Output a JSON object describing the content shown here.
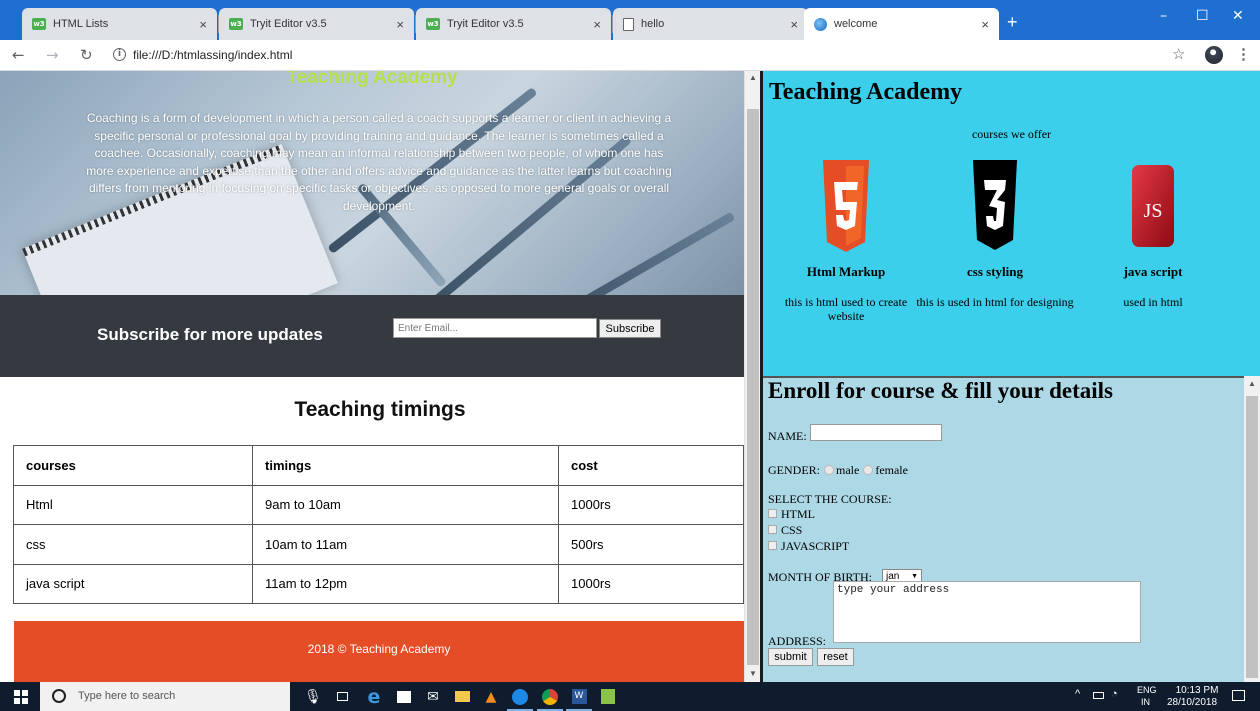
{
  "browser": {
    "tabs": [
      {
        "title": "HTML Lists",
        "icon": "w3-icon"
      },
      {
        "title": "Tryit Editor v3.5",
        "icon": "w3-icon"
      },
      {
        "title": "Tryit Editor v3.5",
        "icon": "w3-icon"
      },
      {
        "title": "hello",
        "icon": "document-icon"
      },
      {
        "title": "welcome",
        "icon": "globe-icon",
        "active": true
      }
    ],
    "close_glyph": "×",
    "new_tab_glyph": "+",
    "url": "file:///D:/htmlassing/index.html",
    "window_controls": [
      "–",
      "☐",
      "✕"
    ]
  },
  "left_page": {
    "hero": {
      "title": "Teaching Academy",
      "text": "Coaching is a form of development in which a person called a coach supports a learner or client in achieving a specific personal or professional goal by providing training and guidance. The learner is sometimes called a coachee. Occasionally, coaching may mean an informal relationship between two people, of whom one has more experience and expertise than the other and offers advice and guidance as the latter learns but coaching differs from mentoring in focusing on specific tasks or objectives, as opposed to more general goals or overall development."
    },
    "subscribe": {
      "title": "Subscribe for more updates",
      "email_placeholder": "Enter Email...",
      "button": "Subscribe"
    },
    "timings": {
      "title": "Teaching timings",
      "headers": [
        "courses",
        "timings",
        "cost"
      ],
      "rows": [
        [
          "Html",
          "9am to 10am",
          "1000rs"
        ],
        [
          "css",
          "10am to 11am",
          "500rs"
        ],
        [
          "java script",
          "11am to 12pm",
          "1000rs"
        ]
      ]
    },
    "footer": "2018 © Teaching Academy"
  },
  "right_top": {
    "title": "Teaching Academy",
    "subtitle": "courses we offer",
    "courses": [
      {
        "name": "Html Markup",
        "desc": "this is html used to create website",
        "logo": "HTML5",
        "color": "#e44d26"
      },
      {
        "name": "css styling",
        "desc": "this is used in html for designing",
        "logo": "CSS3",
        "color": "#000000"
      },
      {
        "name": "java script",
        "desc": "used in html",
        "logo": "JS",
        "color": "#c0131f"
      }
    ],
    "background": "#3ccfeb"
  },
  "right_bottom": {
    "title": "Enroll for course & fill your details",
    "name_label": "NAME:",
    "gender_label": "GENDER:",
    "gender_options": [
      "male",
      "female"
    ],
    "course_label": "SELECT THE COURSE:",
    "course_options": [
      "HTML",
      "CSS",
      "JAVASCRIPT"
    ],
    "month_label": "MONTH OF BIRTH:",
    "month_value": "jan",
    "address_label": "ADDRESS:",
    "address_placeholder": "type your address",
    "submit": "submit",
    "reset": "reset",
    "background": "#add8e6"
  },
  "taskbar": {
    "search_placeholder": "Type here to search",
    "lang_line1": "ENG",
    "lang_line2": "IN",
    "time": "10:13 PM",
    "date": "28/10/2018"
  }
}
